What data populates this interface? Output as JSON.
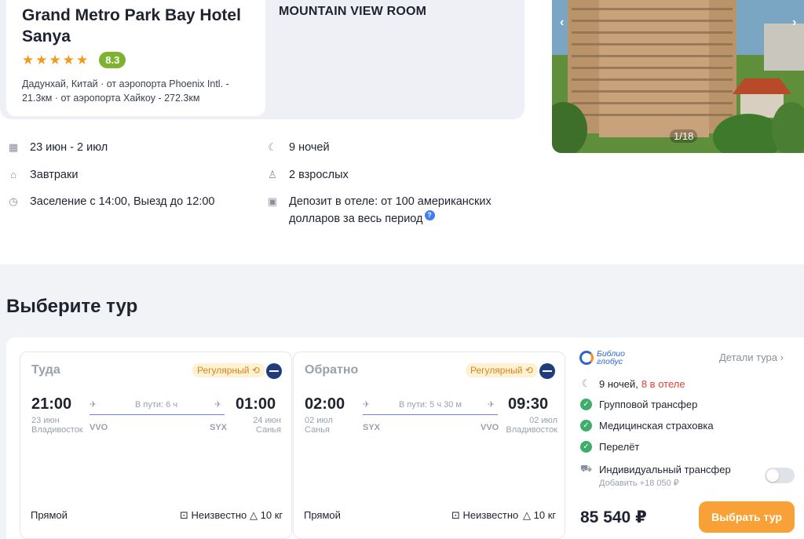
{
  "hotel": {
    "name": "Grand Metro Park Bay Hotel Sanya",
    "stars": 5,
    "score": "8.3",
    "address": "Дадунхай, Китай · от аэропорта Phoenix Intl. - 21.3км · от аэропорта Хайкоу - 272.3км",
    "room": "MOUNTAIN VIEW ROOM"
  },
  "photo": {
    "counter": "1/18"
  },
  "details": {
    "dates": "23 июн - 2 июл",
    "nights": "9 ночей",
    "meal": "Завтраки",
    "guests": "2 взрослых",
    "checkin": "Заселение с 14:00, Выезд до 12:00",
    "deposit": "Депозит в отеле: от 100 американских долларов за весь период",
    "deposit_help": "?"
  },
  "section": {
    "title": "Выберите тур"
  },
  "flights": [
    {
      "label": "Туда",
      "badge": "Регулярный",
      "dep_time": "21:00",
      "dep_date": "23 июн",
      "dep_city": "Владивосток",
      "dep_code": "VVO",
      "duration": "В пути: 6 ч",
      "arr_time": "01:00",
      "arr_date": "24 июн",
      "arr_city": "Санья",
      "arr_code": "SYX",
      "type": "Прямой",
      "baggage": "Неизвестно",
      "hand": "10 кг"
    },
    {
      "label": "Обратно",
      "badge": "Регулярный",
      "dep_time": "02:00",
      "dep_date": "02 июл",
      "dep_city": "Санья",
      "dep_code": "SYX",
      "duration": "В пути: 5 ч 30 м",
      "arr_time": "09:30",
      "arr_date": "02 июл",
      "arr_city": "Владивосток",
      "arr_code": "VVO",
      "type": "Прямой",
      "baggage": "Неизвестно",
      "hand": "10 кг"
    }
  ],
  "panel": {
    "operator_line1": "Библио",
    "operator_line2": "глобус",
    "details_link": "Детали тура",
    "nights": "9 ночей,",
    "nights_highlight": "8 в отеле",
    "features": [
      "Групповой трансфер",
      "Медицинская страховка",
      "Перелёт"
    ],
    "individual_transfer": "Индивидуальный трансфер",
    "individual_add": "Добавить +18 050 ₽",
    "price": "85 540 ₽",
    "cta": "Выбрать тур"
  },
  "colors": {
    "accent": "#f7a137",
    "score": "#7db32f",
    "check": "#3cae6a",
    "highlight": "#e0412f"
  }
}
